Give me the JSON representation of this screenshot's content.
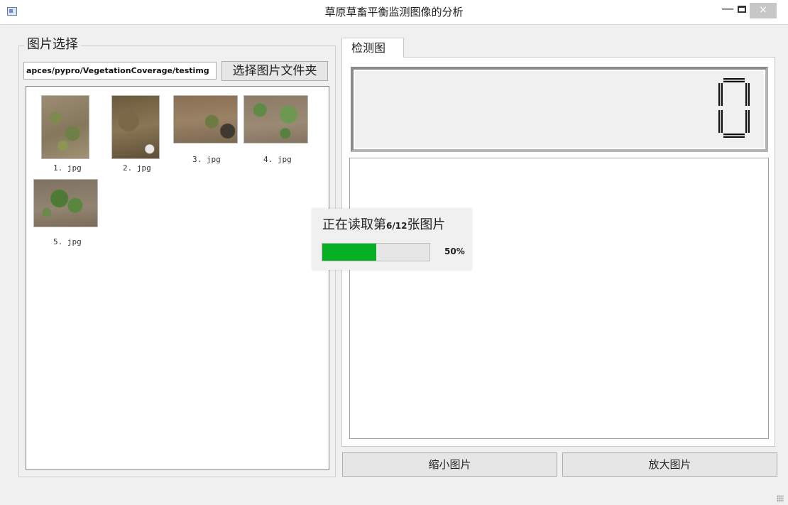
{
  "window": {
    "title": "草原草畜平衡监测图像的分析",
    "minimize_glyph": "—",
    "close_glyph": "×",
    "icon": "app-window-icon"
  },
  "image_select": {
    "group_title": "图片选择",
    "path_value": "apces/pypro/VegetationCoverage/testimg",
    "select_button": "选择图片文件夹",
    "thumbnails": [
      {
        "caption": "1. jpg"
      },
      {
        "caption": "2. jpg"
      },
      {
        "caption": "3. jpg"
      },
      {
        "caption": "4. jpg"
      },
      {
        "caption": "5. jpg"
      }
    ]
  },
  "detection": {
    "tab_label": "检测图",
    "lcd_value": "0",
    "zoom_out_button": "缩小图片",
    "zoom_in_button": "放大图片"
  },
  "progress": {
    "label_prefix": "正在读取第",
    "label_count": "6/12",
    "label_suffix": "张图片",
    "percent": 50,
    "percent_text": "50%",
    "fill_color": "#06b025"
  }
}
